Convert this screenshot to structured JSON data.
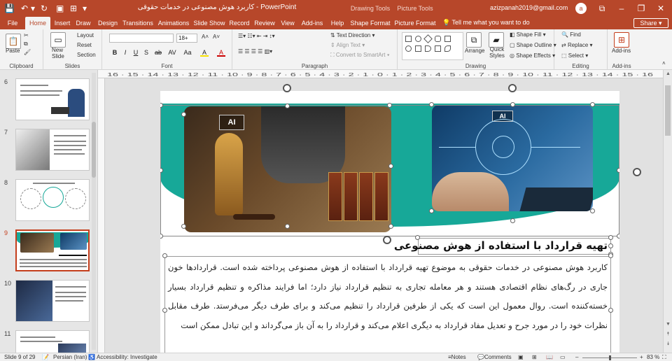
{
  "titlebar": {
    "title": "کاربرد هوش مصنوعی در خدمات حقوقی - PowerPoint",
    "drawing_tools": "Drawing Tools",
    "picture_tools": "Picture Tools",
    "user": "azizpanah2019@gmail.com",
    "avatar_letter": "a"
  },
  "tabs": [
    "File",
    "Home",
    "Insert",
    "Draw",
    "Design",
    "Transitions",
    "Animations",
    "Slide Show",
    "Record",
    "Review",
    "View",
    "Add-ins",
    "Help",
    "Shape Format",
    "Picture Format"
  ],
  "tellme": "Tell me what you want to do",
  "share": "Share",
  "ribbon": {
    "clipboard": {
      "label": "Clipboard",
      "paste": "Paste"
    },
    "slides": {
      "label": "Slides",
      "new_slide": "New Slide",
      "layout": "Layout",
      "reset": "Reset",
      "section": "Section"
    },
    "font": {
      "label": "Font",
      "size": "18+",
      "bold": "B",
      "italic": "I",
      "underline": "U",
      "strike": "S",
      "shadow": "ab",
      "spacing": "AV",
      "case": "Aa",
      "highlight": "A",
      "color": "A"
    },
    "paragraph": {
      "label": "Paragraph",
      "text_direction": "Text Direction",
      "align_text": "Align Text",
      "convert": "Convert to SmartArt"
    },
    "drawing": {
      "label": "Drawing",
      "arrange": "Arrange",
      "quick_styles": "Quick Styles",
      "shape_fill": "Shape Fill",
      "shape_outline": "Shape Outline",
      "shape_effects": "Shape Effects"
    },
    "editing": {
      "label": "Editing",
      "find": "Find",
      "replace": "Replace",
      "select": "Select"
    },
    "addins": {
      "label": "Add-ins",
      "btn": "Add-ins"
    }
  },
  "ruler": "16 · 15 · 14 · 13 · 12 · 11 · 10 · 9 · 8 · 7 · 6 · 5 · 4 · 3 · 2 · 1 · 0 · 1 · 2 · 3 · 4 · 5 · 6 · 7 · 8 · 9 · 10 · 11 · 12 · 13 · 14 · 15 · 16",
  "thumbnails": [
    {
      "num": "6"
    },
    {
      "num": "7"
    },
    {
      "num": "8"
    },
    {
      "num": "9",
      "selected": true
    },
    {
      "num": "10"
    },
    {
      "num": "11"
    }
  ],
  "slide": {
    "ai_badge_1": "AI",
    "ai_badge_2": "AI",
    "title": "تهیه قرارداد با استفاده از هوش مصنوعی",
    "body": "کاربرد هوش مصنوعی در خدمات حقوقی به موضوع تهیه قرارداد با استفاده از هوش مصنوعی پرداخته شده است. قراردادها خون جاری در رگ‌های نظام اقتصادی هستند و هر معامله تجاری به تنظیم قرارداد نیاز دارد؛ اما فرایند مذاکره و تنظیم قرارداد بسیار خسته‌کننده است. روال معمول این است که یکی از طرفین قرارداد را تنظیم می‌کند و برای طرف دیگر می‌فرستد. طرف مقابل نظرات خود را در مورد جرح و تعدیل مفاد قرارداد به دیگری اعلام می‌کند و قرارداد را به آن باز می‌گرداند و این تبادل ممکن است"
  },
  "statusbar": {
    "slide_of": "Slide 9 of 29",
    "language": "Persian (Iran)",
    "accessibility": "Accessibility: Investigate",
    "notes": "Notes",
    "comments": "Comments",
    "zoom": "83 %"
  },
  "colors": {
    "accent": "#b7472a",
    "teal": "#17a898",
    "selected_border": "#c43e1c"
  }
}
